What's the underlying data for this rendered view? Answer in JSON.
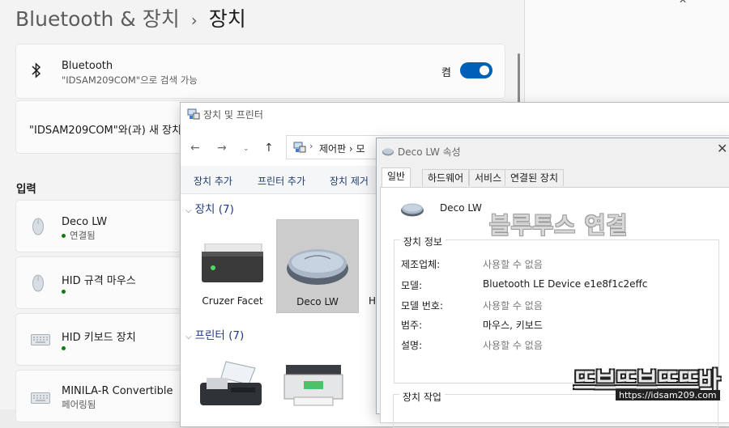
{
  "settings": {
    "breadcrumb_parent": "Bluetooth & 장치",
    "breadcrumb_sep": "›",
    "breadcrumb_current": "장치",
    "bluetooth": {
      "title": "Bluetooth",
      "subtitle": "\"IDSAM209COM\"으로 검색 가능",
      "toggle_label": "켬",
      "toggle_on": true
    },
    "add_device_text": "\"IDSAM209COM\"와(과) 새 장치",
    "section_input": "입력",
    "devices": [
      {
        "name": "Deco LW",
        "status": "연결됨",
        "icon": "mouse-icon"
      },
      {
        "name": "HID 규격 마우스",
        "status": "",
        "icon": "mouse-icon"
      },
      {
        "name": "HID 키보드 장치",
        "status": "",
        "icon": "keyboard-icon"
      },
      {
        "name": "MINILA-R Convertible",
        "status": "페어링됨",
        "icon": "keyboard-icon"
      }
    ]
  },
  "devices_printers": {
    "window_title": "장치 및 프린터",
    "address_crumb": "제어판 › 모",
    "commands": [
      "장치 추가",
      "프린터 추가",
      "장치 제거"
    ],
    "group_devices": "장치 (7)",
    "group_printers": "프린터 (7)",
    "tiles": [
      {
        "label": "Cruzer Facet",
        "icon": "usb-drive-icon",
        "selected": false
      },
      {
        "label": "Deco LW",
        "icon": "mouse-icon",
        "selected": true
      },
      {
        "label": "H",
        "icon": "device-icon",
        "selected": false
      }
    ]
  },
  "properties": {
    "title": "Deco LW 속성",
    "tabs": [
      "일반",
      "하드웨어",
      "서비스",
      "연결된 장치"
    ],
    "active_tab": 0,
    "device_name": "Deco LW",
    "group_info": "장치 정보",
    "rows": [
      {
        "label": "제조업체:",
        "value": "사용할 수 없음",
        "muted": true
      },
      {
        "label": "모델:",
        "value": "Bluetooth LE Device e1e8f1c2effc",
        "muted": false
      },
      {
        "label": "모델 번호:",
        "value": "사용할 수 없음",
        "muted": true
      },
      {
        "label": "범주:",
        "value": "마우스, 키보드",
        "muted": false
      },
      {
        "label": "설명:",
        "value": "사용할 수 없음",
        "muted": true
      }
    ],
    "group_tasks": "장치 작업"
  },
  "watermarks": {
    "caption": "블루투스 연결",
    "logo": "뜨브뜨브뜨뜨바",
    "url": "https://idsam209.com"
  },
  "colors": {
    "accent": "#005fb8",
    "connected": "#0f7b0f",
    "link": "#1e3a8a"
  }
}
